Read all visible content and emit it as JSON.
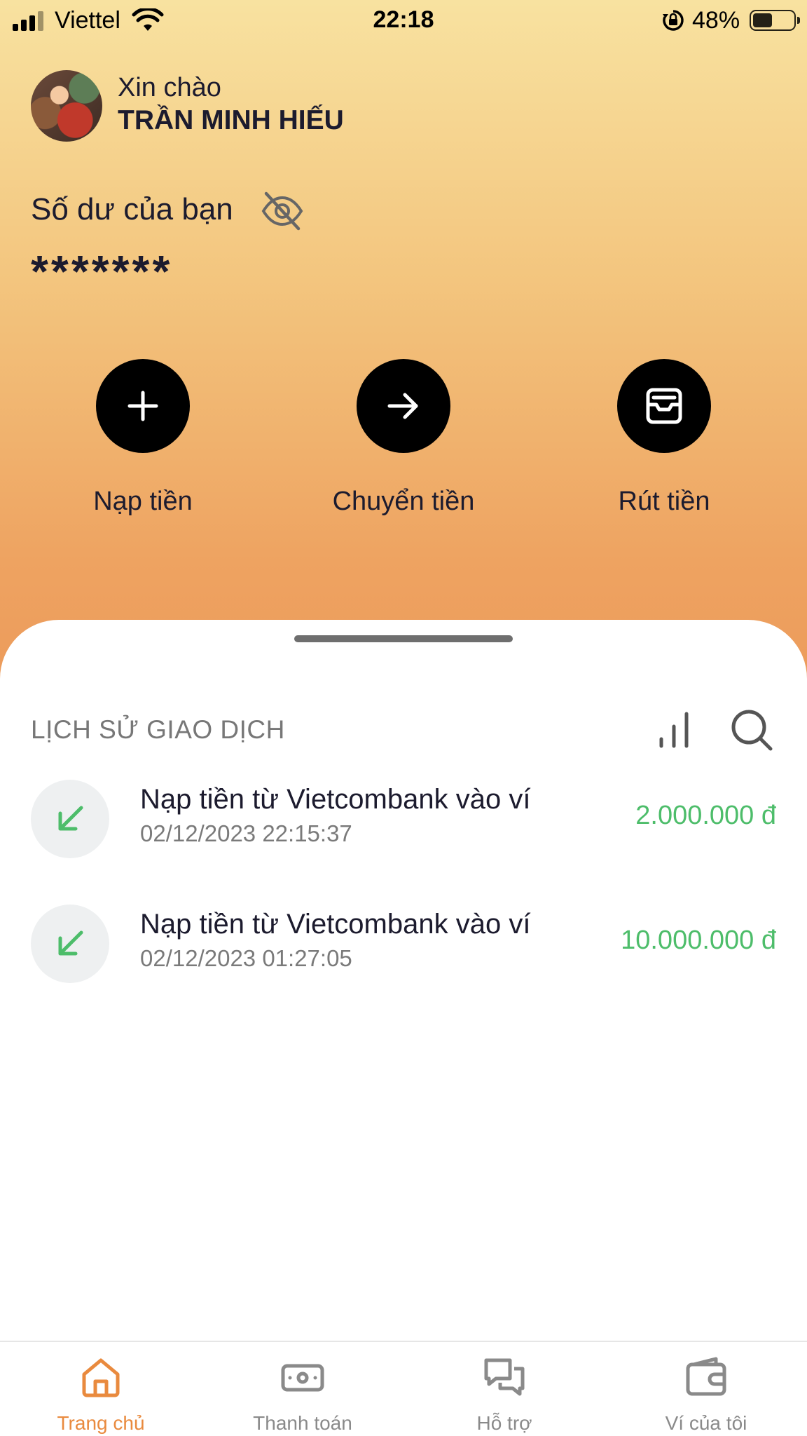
{
  "status_bar": {
    "carrier": "Viettel",
    "time": "22:18",
    "battery": "48%",
    "battery_level": 0.48
  },
  "header": {
    "greeting": "Xin chào",
    "user_name": "TRẦN MINH HIẾU"
  },
  "balance": {
    "label": "Số dư của bạn",
    "value": "*******"
  },
  "actions": [
    {
      "label": "Nạp tiền",
      "icon": "plus-icon"
    },
    {
      "label": "Chuyển tiền",
      "icon": "arrow-right-icon"
    },
    {
      "label": "Rút tiền",
      "icon": "inbox-icon"
    }
  ],
  "history": {
    "title": "LỊCH SỬ GIAO DỊCH",
    "transactions": [
      {
        "title": "Nạp tiền từ Vietcombank vào ví",
        "time": "02/12/2023 22:15:37",
        "amount": "2.000.000 đ"
      },
      {
        "title": "Nạp tiền từ Vietcombank vào ví",
        "time": "02/12/2023 01:27:05",
        "amount": "10.000.000 đ"
      }
    ]
  },
  "bottom_nav": [
    {
      "label": "Trang chủ",
      "icon": "home-icon",
      "active": true
    },
    {
      "label": "Thanh toán",
      "icon": "cash-icon",
      "active": false
    },
    {
      "label": "Hỗ trợ",
      "icon": "chat-icon",
      "active": false
    },
    {
      "label": "Ví của tôi",
      "icon": "wallet-icon",
      "active": false
    }
  ],
  "colors": {
    "accent": "#e98a3e",
    "amount_green": "#4dbd6a",
    "gradient_top": "#f8e2a0",
    "gradient_bottom": "#ec9a5a"
  }
}
